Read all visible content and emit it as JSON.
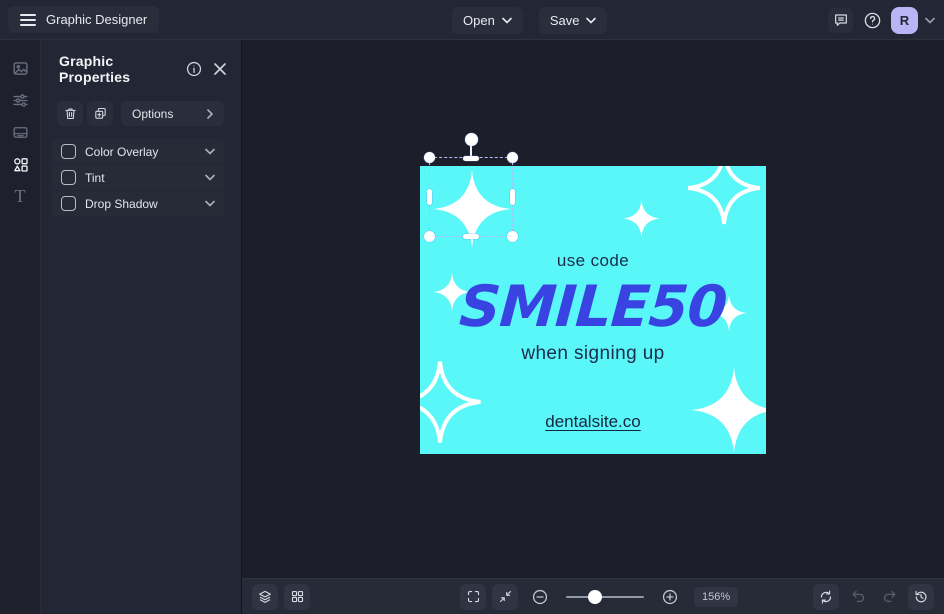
{
  "topbar": {
    "app_title": "Graphic Designer",
    "open_label": "Open",
    "save_label": "Save",
    "avatar_initial": "R"
  },
  "rail": {
    "tools": [
      "images",
      "adjustments",
      "templates",
      "elements",
      "text"
    ],
    "active_tool": "elements",
    "text_glyph": "T"
  },
  "panel": {
    "title": "Graphic Properties",
    "options_label": "Options",
    "properties": [
      {
        "label": "Color Overlay",
        "checked": false
      },
      {
        "label": "Tint",
        "checked": false
      },
      {
        "label": "Drop Shadow",
        "checked": false
      }
    ]
  },
  "canvas": {
    "graphic": {
      "line1": "use code",
      "promo_code": "SMILE50",
      "line2": "when signing up",
      "link": "dentalsite.co",
      "background_color": "#59F7F8",
      "code_color": "#3843E2",
      "text_color": "#1C2B4C"
    },
    "selection": {
      "target": "sparkle",
      "handle_color": "#FFFFFF",
      "dash_color": "#B3BDF7"
    }
  },
  "bottombar": {
    "zoom_level": "156%"
  },
  "glyphs": {
    "help": "?",
    "info": "i"
  },
  "colors": {
    "app_bg": "#1C1F2A",
    "bar_bg": "#232634",
    "button_bg": "#2A2E3C",
    "avatar_bg": "#B7B5F4"
  }
}
